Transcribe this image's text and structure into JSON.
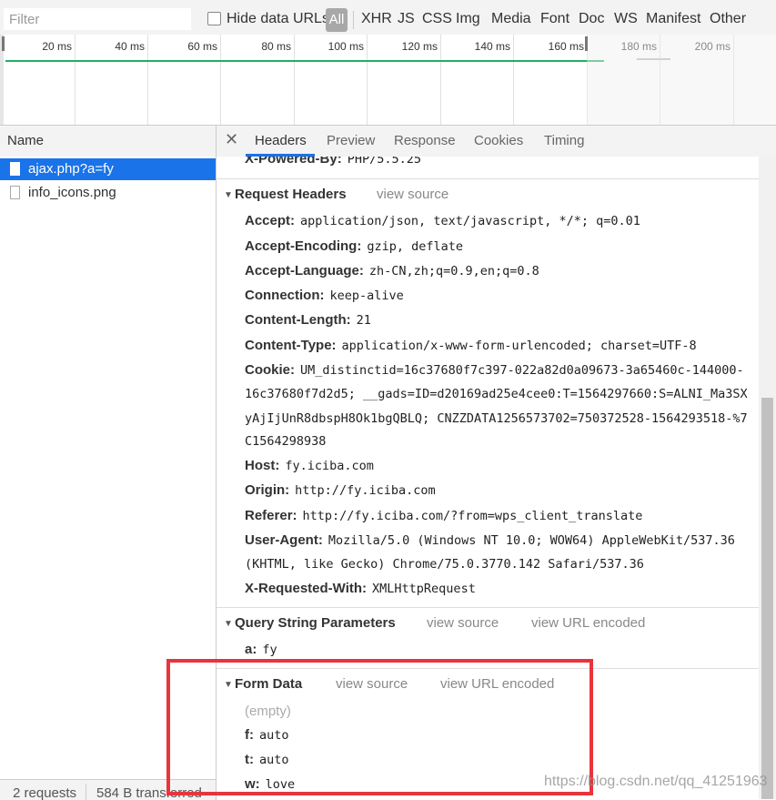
{
  "toolbar": {
    "filter_placeholder": "Filter",
    "hide_data_urls": "Hide data URLs",
    "all": "All",
    "types": [
      "XHR",
      "JS",
      "CSS",
      "Img",
      "Media",
      "Font",
      "Doc",
      "WS",
      "Manifest",
      "Other"
    ]
  },
  "timeline": {
    "ticks": [
      "20 ms",
      "40 ms",
      "60 ms",
      "80 ms",
      "100 ms",
      "120 ms",
      "140 ms",
      "160 ms",
      "180 ms",
      "200 ms"
    ]
  },
  "requests": {
    "header": "Name",
    "items": [
      {
        "name": "ajax.php?a=fy",
        "selected": true
      },
      {
        "name": "info_icons.png",
        "selected": false
      }
    ]
  },
  "status": {
    "requests": "2 requests",
    "transferred": "584 B transferred"
  },
  "tabs": [
    "Headers",
    "Preview",
    "Response",
    "Cookies",
    "Timing"
  ],
  "active_tab": "Headers",
  "detail": {
    "top_partial": {
      "key": "X-Powered-By:",
      "value": "PHP/5.5.25"
    },
    "request_headers": {
      "title": "Request Headers",
      "view_source": "view source",
      "rows": [
        {
          "key": "Accept:",
          "value": "application/json, text/javascript, */*; q=0.01"
        },
        {
          "key": "Accept-Encoding:",
          "value": "gzip, deflate"
        },
        {
          "key": "Accept-Language:",
          "value": "zh-CN,zh;q=0.9,en;q=0.8"
        },
        {
          "key": "Connection:",
          "value": "keep-alive"
        },
        {
          "key": "Content-Length:",
          "value": "21"
        },
        {
          "key": "Content-Type:",
          "value": "application/x-www-form-urlencoded; charset=UTF-8"
        },
        {
          "key": "Cookie:",
          "value": "UM_distinctid=16c37680f7c397-022a82d0a09673-3a65460c-144000-"
        },
        {
          "key": "Host:",
          "value": "fy.iciba.com"
        },
        {
          "key": "Origin:",
          "value": "http://fy.iciba.com"
        },
        {
          "key": "Referer:",
          "value": "http://fy.iciba.com/?from=wps_client_translate"
        },
        {
          "key": "User-Agent:",
          "value": "Mozilla/5.0 (Windows NT 10.0; WOW64) AppleWebKit/537.36"
        },
        {
          "key": "X-Requested-With:",
          "value": "XMLHttpRequest"
        }
      ],
      "cookie_cont": [
        "16c37680f7d2d5; __gads=ID=d20169ad25e4cee0:T=1564297660:S=ALNI_Ma3SX",
        "yAjIjUnR8dbspH8Ok1bgQBLQ; CNZZDATA1256573702=750372528-1564293518-%7",
        "C1564298938"
      ],
      "ua_cont": "(KHTML, like Gecko) Chrome/75.0.3770.142 Safari/537.36"
    },
    "query_params": {
      "title": "Query String Parameters",
      "view_source": "view source",
      "view_url_encoded": "view URL encoded",
      "rows": [
        {
          "key": "a:",
          "value": "fy"
        }
      ]
    },
    "form_data": {
      "title": "Form Data",
      "view_source": "view source",
      "view_url_encoded": "view URL encoded",
      "empty": "(empty)",
      "rows": [
        {
          "key": "f:",
          "value": "auto"
        },
        {
          "key": "t:",
          "value": "auto"
        },
        {
          "key": "w:",
          "value": "love"
        }
      ]
    }
  },
  "watermark": "https://blog.csdn.net/qq_41251963",
  "colors": {
    "accent": "#1a73e8",
    "highlight_box": "#e9343c",
    "timeline_bar": "#20b060"
  }
}
